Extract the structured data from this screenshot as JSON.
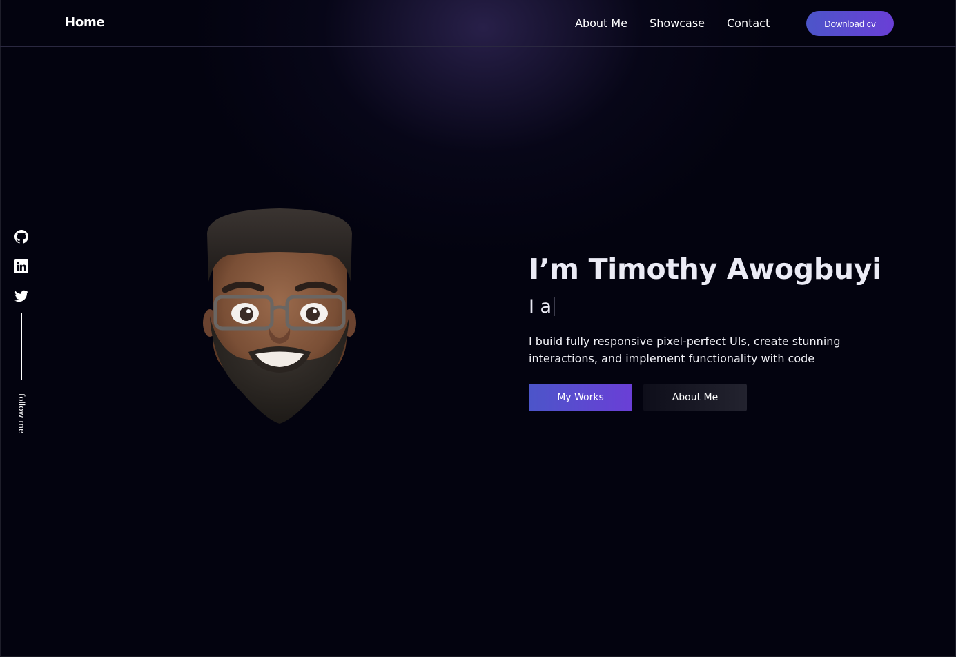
{
  "header": {
    "brand": "Home",
    "nav": [
      {
        "label": "About Me"
      },
      {
        "label": "Showcase"
      },
      {
        "label": "Contact"
      }
    ],
    "download_label": "Download cv"
  },
  "sidebar": {
    "icons": [
      "github-icon",
      "linkedin-icon",
      "twitter-icon"
    ],
    "follow_label": "follow me"
  },
  "hero": {
    "title": "I’m Timothy Awogbuyi",
    "typed_text": "I a",
    "description": "I build fully responsive pixel-perfect UIs, create stunning interactions, and implement functionality with code",
    "primary_button": "My Works",
    "secondary_button": "About Me"
  },
  "colors": {
    "background": "#03030f",
    "accent_start": "#4c55c9",
    "accent_end": "#6a3fd6",
    "text": "#ebebf5"
  }
}
